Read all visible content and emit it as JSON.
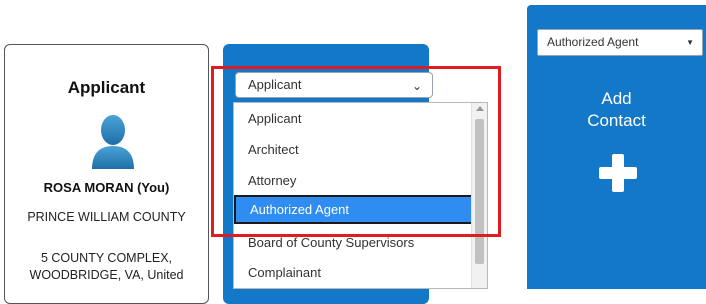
{
  "applicant_card": {
    "role": "Applicant",
    "name": "ROSA MORAN (You)",
    "county": "PRINCE WILLIAM COUNTY",
    "address_line1": "5 COUNTY COMPLEX,",
    "address_line2": "WOODBRIDGE, VA, United"
  },
  "contact_type_select": {
    "value": "Applicant",
    "options": [
      "Applicant",
      "Architect",
      "Attorney",
      "Authorized Agent",
      "Board of County Supervisors",
      "Complainant"
    ],
    "highlighted_option": "Authorized Agent"
  },
  "add_contact_panel": {
    "select_value": "Authorized Agent",
    "label_line1": "Add",
    "label_line2": "Contact"
  },
  "colors": {
    "panel_blue": "#1478c8",
    "selected_option": "#2f8cf1",
    "highlight_red": "#e11b22"
  }
}
